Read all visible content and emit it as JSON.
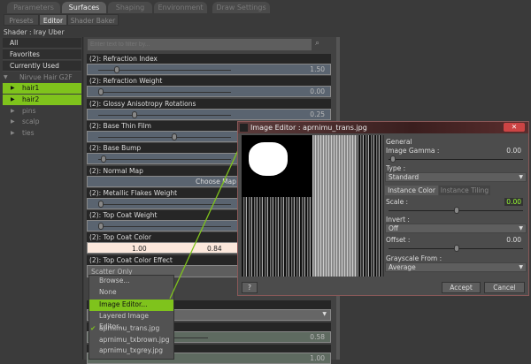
{
  "tabs": [
    "Parameters",
    "Surfaces",
    "Shaping",
    "Environment",
    "Draw Settings"
  ],
  "subtabs": [
    "Presets",
    "Editor",
    "Shader Baker"
  ],
  "shader_label": "Shader : Iray Uber",
  "filters": [
    "All",
    "Favorites",
    "Currently Used"
  ],
  "tree": {
    "root": "Nirvue Hair G2F",
    "items": [
      "hair1",
      "hair2",
      "pins",
      "scalp",
      "ties"
    ]
  },
  "filter_placeholder": "Enter text to filter by...",
  "props": [
    {
      "label": "(2): Refraction Index",
      "value": "1.50",
      "fill": 0.12
    },
    {
      "label": "(2): Refraction Weight",
      "value": "0.00",
      "fill": 0.0
    },
    {
      "label": "(2): Glossy Anisotropy Rotations",
      "value": "0.25",
      "fill": 0.25
    },
    {
      "label": "(2): Base Thin Film",
      "value": "",
      "fill": 0.55
    },
    {
      "label": "(2): Base Bump",
      "value": "",
      "fill": 0.02
    },
    {
      "label": "(2): Normal Map",
      "value": "Choose Map"
    },
    {
      "label": "(2): Metallic Flakes Weight",
      "value": "",
      "fill": 0.0
    },
    {
      "label": "(2): Top Coat Weight",
      "value": "",
      "fill": 0.0
    },
    {
      "label": "(2): Top Coat Color",
      "value": "1.00",
      "value2": "0.84"
    },
    {
      "label": "(2): Top Coat Color Effect",
      "value": "Scatter Only"
    }
  ],
  "lower_values": [
    "0.58",
    "1.00"
  ],
  "menu": [
    "Browse...",
    "None",
    "Image Editor...",
    "Layered Image Editor...",
    "aprnimu_trans.jpg",
    "aprnimu_txbrown.jpg",
    "aprnimu_txgrey.jpg"
  ],
  "dialog": {
    "title": "Image Editor : aprnimu_trans.jpg",
    "general": "General",
    "gamma_label": "Image Gamma :",
    "gamma": "0.00",
    "type_label": "Type :",
    "type": "Standard",
    "tabs": [
      "Instance Color",
      "Instance Tiling"
    ],
    "scale_label": "Scale :",
    "scale": "0.00",
    "invert_label": "Invert :",
    "invert": "Off",
    "offset_label": "Offset :",
    "offset": "0.00",
    "gray_label": "Grayscale From :",
    "gray": "Average",
    "accept": "Accept",
    "cancel": "Cancel"
  },
  "accent": "#7fc31c"
}
